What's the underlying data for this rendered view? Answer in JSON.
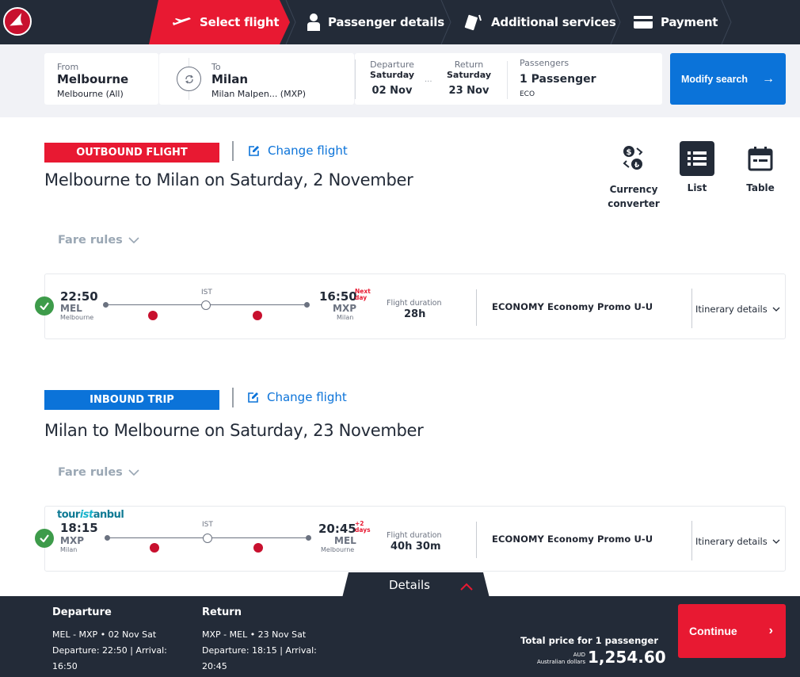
{
  "nav": {
    "steps": [
      {
        "label": "Select flight",
        "icon": "plane-icon",
        "active": true
      },
      {
        "label": "Passenger details",
        "icon": "person-icon",
        "active": false
      },
      {
        "label": "Additional services",
        "icon": "cards-icon",
        "active": false
      },
      {
        "label": "Payment",
        "icon": "credit-card-icon",
        "active": false
      }
    ]
  },
  "search": {
    "from_label": "From",
    "from_city": "Melbourne",
    "from_airport": "Melbourne (All)",
    "to_label": "To",
    "to_city": "Milan",
    "to_airport": "Milan Malpen...  (MXP)",
    "departure_label": "Departure",
    "departure_day": "Saturday",
    "departure_date": "02 Nov",
    "separator": "...",
    "return_label": "Return",
    "return_day": "Saturday",
    "return_date": "23 Nov",
    "passengers_label": "Passengers",
    "passengers_value": "1 Passenger",
    "cabin": "ECO",
    "modify_label": "Modify search",
    "modify_arrow": "→"
  },
  "views": {
    "currency": "Currency converter",
    "list": "List",
    "table": "Table"
  },
  "outbound": {
    "badge": "OUTBOUND FLIGHT",
    "badge_color": "#e81932",
    "change_label": "Change flight",
    "title": "Melbourne to Milan on Saturday, 2 November",
    "fare_rules": "Fare rules",
    "dep_time": "22:50",
    "dep_code": "MEL",
    "dep_city": "Melbourne",
    "stop": "IST",
    "arr_time": "16:50",
    "arr_note_1": "Next",
    "arr_note_2": "day",
    "arr_code": "MXP",
    "arr_city": "Milan",
    "duration_label": "Flight duration",
    "duration": "28h",
    "fare": "ECONOMY Economy Promo U-U",
    "itinerary": "Itinerary details"
  },
  "inbound": {
    "badge": "INBOUND TRIP",
    "badge_color": "#0b73d9",
    "change_label": "Change flight",
    "title": "Milan to Melbourne on Saturday, 23 November",
    "fare_rules": "Fare rules",
    "promo_pre": "tour",
    "promo_mid": "ist",
    "promo_post": "anbul",
    "dep_time": "18:15",
    "dep_code": "MXP",
    "dep_city": "Milan",
    "stop": "IST",
    "arr_time": "20:45",
    "arr_note_1": "+2",
    "arr_note_2": "days",
    "arr_code": "MEL",
    "arr_city": "Melbourne",
    "duration_label": "Flight duration",
    "duration": "40h 30m",
    "fare": "ECONOMY Economy Promo U-U",
    "itinerary": "Itinerary details"
  },
  "summary": {
    "details_tab": "Details",
    "departure_head": "Departure",
    "departure_route": "MEL  -  MXP  •  02 Nov Sat",
    "departure_times": "Departure: 22:50 | Arrival:",
    "departure_arrival": "16:50",
    "return_head": "Return",
    "return_route": "MXP  -  MEL  •  23 Nov Sat",
    "return_times": "Departure: 18:15 | Arrival:",
    "return_arrival": "20:45",
    "total_label": "Total price for 1 passenger",
    "currency_code": "AUD",
    "currency_name": "Australian dollars",
    "price": "1,254.60",
    "continue_label": "Continue",
    "continue_arrow": "›"
  }
}
